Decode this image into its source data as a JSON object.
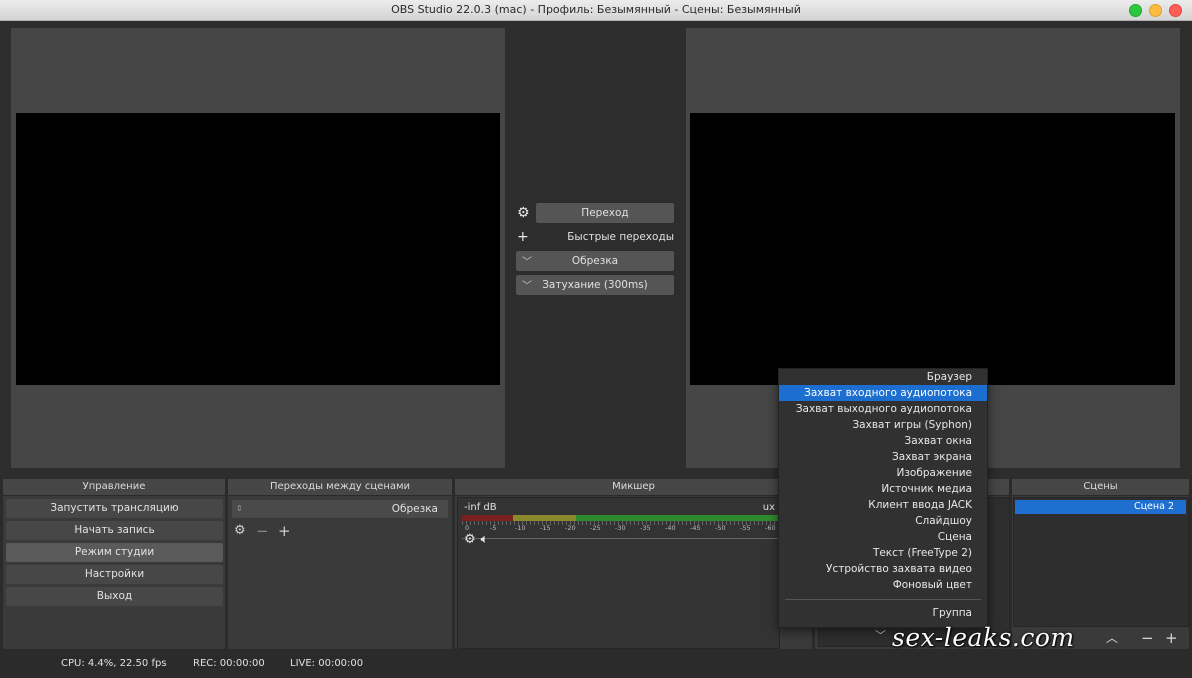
{
  "window": {
    "title": "OBS Studio 22.0.3 (mac) - Профиль: Безымянный - Сцены: Безымянный"
  },
  "transition_panel": {
    "transition_button": "Переход",
    "quick_transitions_label": "Быстрые переходы",
    "quick_items": [
      "Обрезка",
      "Затухание (300ms)"
    ]
  },
  "controls": {
    "title": "Управление",
    "buttons": [
      "Запустить трансляцию",
      "Начать запись",
      "Режим студии",
      "Настройки",
      "Выход"
    ]
  },
  "scene_transitions": {
    "title": "Переходы между сценами",
    "selected": "Обрезка"
  },
  "mixer": {
    "title": "Микшер",
    "level": "-inf dB",
    "source_suffix": "ux",
    "ticks": [
      "0",
      "-5",
      "-10",
      "-15",
      "-20",
      "-25",
      "-30",
      "-35",
      "-40",
      "-45",
      "-50",
      "-55",
      "-60"
    ]
  },
  "scenes": {
    "title": "Сцены",
    "items": [
      "Сцена 2"
    ]
  },
  "context_menu": {
    "items": [
      "Браузер",
      "Захват входного аудиопотока",
      "Захват выходного аудиопотока",
      "Захват игры (Syphon)",
      "Захват окна",
      "Захват экрана",
      "Изображение",
      "Источник медиа",
      "Клиент ввода JACK",
      "Слайдшоу",
      "Сцена",
      "Текст (FreeType 2)",
      "Устройство захвата видео",
      "Фоновый цвет"
    ],
    "group_item": "Группа",
    "highlighted": "Захват входного аудиопотока"
  },
  "status": {
    "live": "LIVE: 00:00:00",
    "rec": "REC: 00:00:00",
    "cpu": "CPU: 4.4%, 22.50 fps"
  },
  "watermark": "sex-leaks.com"
}
